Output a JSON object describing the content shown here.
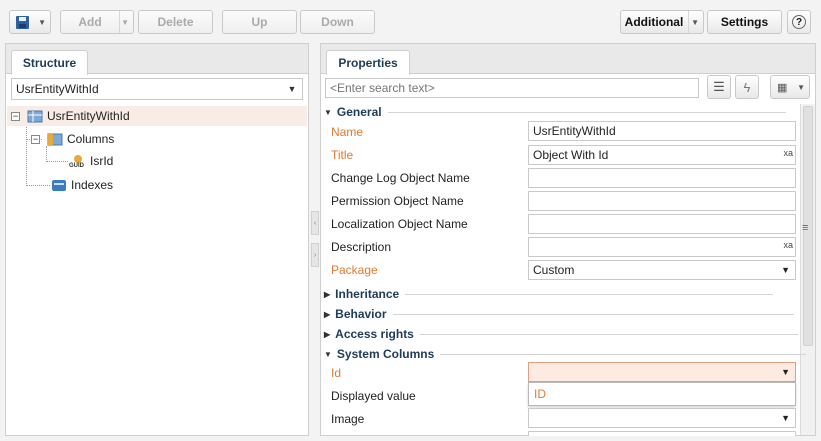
{
  "toolbar": {
    "add": "Add",
    "delete": "Delete",
    "up": "Up",
    "down": "Down",
    "additional": "Additional",
    "settings": "Settings",
    "help": "?"
  },
  "structure": {
    "tab": "Structure",
    "selected_object": "UsrEntityWithId",
    "tree": {
      "root": "UsrEntityWithId",
      "columns": "Columns",
      "column_item": "IsrId",
      "guid_badge": "GUID",
      "indexes": "Indexes"
    }
  },
  "properties": {
    "tab": "Properties",
    "search_placeholder": "<Enter search text>",
    "groups": {
      "general": "General",
      "inheritance": "Inheritance",
      "behavior": "Behavior",
      "access_rights": "Access rights",
      "system_columns": "System Columns"
    },
    "labels": {
      "name": "Name",
      "title": "Title",
      "change_log": "Change Log Object Name",
      "permission": "Permission Object Name",
      "localization": "Localization Object Name",
      "description": "Description",
      "package": "Package",
      "id": "Id",
      "displayed_value": "Displayed value",
      "image": "Image"
    },
    "values": {
      "name": "UsrEntityWithId",
      "title": "Object With Id",
      "change_log": "",
      "permission": "",
      "localization": "",
      "description": "",
      "package": "Custom",
      "id": "",
      "image": ""
    },
    "dropdown_option": "ID",
    "localize_icon_text": "xa"
  },
  "colors": {
    "required_label": "#e07a33",
    "group_title": "#1d3b5a",
    "active_field": "#fdebe2",
    "selected_row": "#f7ece6"
  }
}
